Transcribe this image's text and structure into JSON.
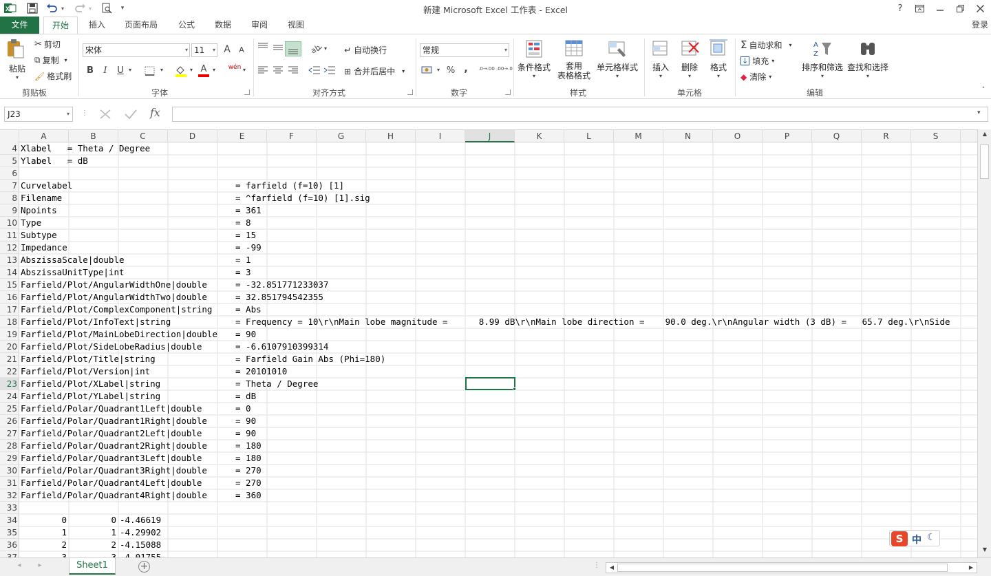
{
  "window": {
    "title": "新建 Microsoft Excel 工作表 - Excel",
    "help": "?",
    "login": "登录"
  },
  "tabs": [
    "文件",
    "开始",
    "插入",
    "页面布局",
    "公式",
    "数据",
    "审阅",
    "视图"
  ],
  "ribbon": {
    "clipboard": {
      "label": "剪贴板",
      "paste": "粘贴",
      "cut": "剪切",
      "copy": "复制",
      "format_painter": "格式刷"
    },
    "font": {
      "label": "字体",
      "name": "宋体",
      "size": "11",
      "grow": "A",
      "shrink": "A",
      "bold": "B",
      "italic": "I",
      "underline": "U",
      "color_a": "A",
      "wen": "wén"
    },
    "align": {
      "label": "对齐方式",
      "wrap": "自动换行",
      "merge": "合并后居中"
    },
    "number": {
      "label": "数字",
      "format": "常规",
      "percent": "%",
      "comma": ",",
      "inc": ".0→.00",
      "dec": ".00→.0"
    },
    "styles": {
      "label": "样式",
      "conditional": "条件格式",
      "table_line1": "套用",
      "table_line2": "表格格式",
      "cell_styles": "单元格样式"
    },
    "cells": {
      "label": "单元格",
      "insert": "插入",
      "delete": "删除",
      "format": "格式"
    },
    "editing": {
      "label": "编辑",
      "autosum": "自动求和",
      "fill": "填充",
      "clear": "清除",
      "sort_filter": "排序和筛选",
      "find_select": "查找和选择"
    }
  },
  "formula_bar": {
    "name_box": "J23",
    "fx": "fx",
    "formula": ""
  },
  "columns": [
    "A",
    "B",
    "C",
    "D",
    "E",
    "F",
    "G",
    "H",
    "I",
    "J",
    "K",
    "L",
    "M",
    "N",
    "O",
    "P",
    "Q",
    "R",
    "S"
  ],
  "selected_column": "J",
  "selected_row": "23",
  "rows": [
    {
      "n": "4",
      "a": "Xlabel   = Theta / Degree",
      "e": ""
    },
    {
      "n": "5",
      "a": "Ylabel   = dB",
      "e": ""
    },
    {
      "n": "6",
      "a": "",
      "e": ""
    },
    {
      "n": "7",
      "a": "Curvelabel",
      "e": "= farfield (f=10) [1]"
    },
    {
      "n": "8",
      "a": "Filename",
      "e": "= ^farfield (f=10) [1].sig"
    },
    {
      "n": "9",
      "a": "Npoints",
      "e": "= 361"
    },
    {
      "n": "10",
      "a": "Type",
      "e": "= 8"
    },
    {
      "n": "11",
      "a": "Subtype",
      "e": "= 15"
    },
    {
      "n": "12",
      "a": "Impedance",
      "e": "= -99"
    },
    {
      "n": "13",
      "a": "AbszissaScale|double",
      "e": "= 1"
    },
    {
      "n": "14",
      "a": "AbszissaUnitType|int",
      "e": "= 3"
    },
    {
      "n": "15",
      "a": "Farfield/Plot/AngularWidthOne|double",
      "e": "= -32.851771233037"
    },
    {
      "n": "16",
      "a": "Farfield/Plot/AngularWidthTwo|double",
      "e": "= 32.851794542355"
    },
    {
      "n": "17",
      "a": "Farfield/Plot/ComplexComponent|string",
      "e": "= Abs"
    },
    {
      "n": "18",
      "a": "Farfield/Plot/InfoText|string",
      "e": "= Frequency = 10\\r\\nMain lobe magnitude =      8.99 dB\\r\\nMain lobe direction =    90.0 deg.\\r\\nAngular width (3 dB) =   65.7 deg.\\r\\nSide"
    },
    {
      "n": "19",
      "a": "Farfield/Plot/MainLobeDirection|double",
      "e": "= 90"
    },
    {
      "n": "20",
      "a": "Farfield/Plot/SideLobeRadius|double",
      "e": "= -6.6107910399314"
    },
    {
      "n": "21",
      "a": "Farfield/Plot/Title|string",
      "e": "= Farfield Gain Abs (Phi=180)"
    },
    {
      "n": "22",
      "a": "Farfield/Plot/Version|int",
      "e": "= 20101010"
    },
    {
      "n": "23",
      "a": "Farfield/Plot/XLabel|string",
      "e": "= Theta / Degree"
    },
    {
      "n": "24",
      "a": "Farfield/Plot/YLabel|string",
      "e": "= dB"
    },
    {
      "n": "25",
      "a": "Farfield/Polar/Quadrant1Left|double",
      "e": "= 0"
    },
    {
      "n": "26",
      "a": "Farfield/Polar/Quadrant1Right|double",
      "e": "= 90"
    },
    {
      "n": "27",
      "a": "Farfield/Polar/Quadrant2Left|double",
      "e": "= 90"
    },
    {
      "n": "28",
      "a": "Farfield/Polar/Quadrant2Right|double",
      "e": "= 180"
    },
    {
      "n": "29",
      "a": "Farfield/Polar/Quadrant3Left|double",
      "e": "= 180"
    },
    {
      "n": "30",
      "a": "Farfield/Polar/Quadrant3Right|double",
      "e": "= 270"
    },
    {
      "n": "31",
      "a": "Farfield/Polar/Quadrant4Left|double",
      "e": "= 270"
    },
    {
      "n": "32",
      "a": "Farfield/Polar/Quadrant4Right|double",
      "e": "= 360"
    },
    {
      "n": "33",
      "a": "",
      "e": ""
    }
  ],
  "numeric_rows": [
    {
      "n": "34",
      "a": "0",
      "b": "0",
      "c": "-4.46619"
    },
    {
      "n": "35",
      "a": "1",
      "b": "1",
      "c": "-4.29902"
    },
    {
      "n": "36",
      "a": "2",
      "b": "2",
      "c": "-4.15088"
    },
    {
      "n": "37",
      "a": "3",
      "b": "3",
      "c": "-4.01755"
    }
  ],
  "sheet": {
    "name": "Sheet1"
  },
  "ime": {
    "label": "中"
  },
  "colors": {
    "excel_green": "#217346"
  }
}
